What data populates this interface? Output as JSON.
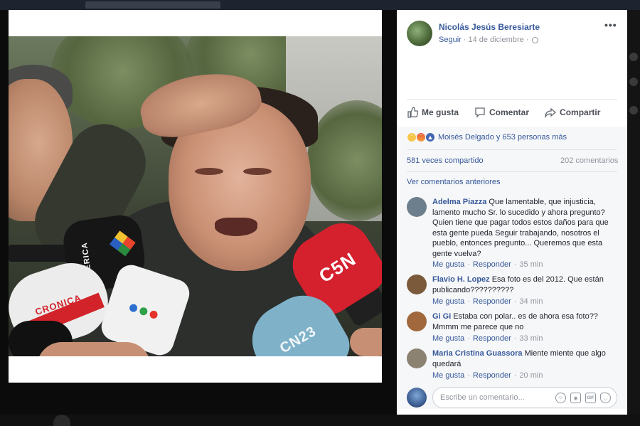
{
  "post": {
    "author": "Nicolás Jesús Beresiarte",
    "follow_label": "Seguir",
    "date": "14 de diciembre",
    "meta_separator": "·",
    "more_label": "•••"
  },
  "actions": {
    "like": "Me gusta",
    "comment": "Comentar",
    "share": "Compartir"
  },
  "reactions": {
    "summary": "Moisés Delgado y 653 personas más",
    "types": [
      "sad",
      "angry",
      "like"
    ]
  },
  "stats": {
    "shares": "581 veces compartido",
    "comments": "202 comentarios"
  },
  "previous_comments": "Ver comentarios anteriores",
  "comment_actions": {
    "like": "Me gusta",
    "reply": "Responder",
    "separator": "·"
  },
  "comments": [
    {
      "name": "Adelma Piazza",
      "text": "Que lamentable, que injusticia, lamento mucho Sr. lo sucedido y ahora pregunto? Quien tiene que pagar todos estos daños para que esta gente pueda Seguir trabajando, nosotros el pueblo, entonces pregunto... Queremos que esta gente vuelva?",
      "time": "35 min",
      "avatar_color": "#6d7f8c"
    },
    {
      "name": "Flavio H. Lopez",
      "text": "Esa foto es del 2012. Que están publicando??????????",
      "time": "34 min",
      "avatar_color": "#7a5a3a"
    },
    {
      "name": "Gi Gi",
      "text": "Estaba con polar.. es de ahora esa foto?? Mmmm me parece que no",
      "time": "33 min",
      "avatar_color": "#a0683c"
    },
    {
      "name": "Maria Cristina Guassora",
      "text": "Miente miente que algo quedará",
      "time": "20 min",
      "avatar_color": "#8b8272"
    }
  ],
  "composer": {
    "placeholder": "Escribe un comentario..."
  },
  "photo": {
    "mic_labels": {
      "america": "AMERICA",
      "c5n": "C5N",
      "cn23": "CN23",
      "cronica": "CRONICA"
    }
  },
  "background": {
    "ghost_text": "Me gusta · Responder"
  },
  "colors": {
    "link": "#365899",
    "muted": "#90949c",
    "like_blue": "#4267b2"
  }
}
